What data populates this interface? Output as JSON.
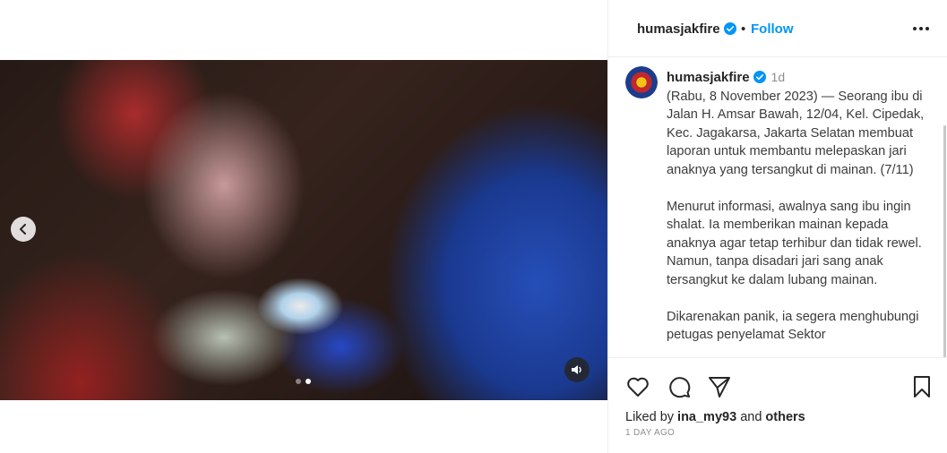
{
  "header": {
    "username": "humasjakfire",
    "separator": "•",
    "follow_label": "Follow",
    "more_icon": "more-horizontal-icon"
  },
  "post": {
    "media_description_icon": "video-carousel",
    "carousel": {
      "total": 2,
      "active": 2
    },
    "audio_icon": "speaker-icon"
  },
  "caption": {
    "username": "humasjakfire",
    "time_ago": "1d",
    "paragraphs": [
      "(Rabu, 8 November 2023) — Seorang ibu di Jalan H. Amsar Bawah, 12/04, Kel. Cipedak, Kec. Jagakarsa, Jakarta Selatan membuat laporan untuk membantu melepaskan jari anaknya yang tersangkut di mainan. (7/11)",
      "Menurut informasi, awalnya sang ibu ingin shalat. Ia memberikan mainan kepada anaknya agar tetap terhibur dan tidak rewel. Namun, tanpa disadari jari sang anak tersangkut ke dalam lubang mainan.",
      "Dikarenakan panik, ia segera menghubungi petugas penyelamat Sektor"
    ]
  },
  "likes": {
    "prefix": "Liked by",
    "user": "ina_my93",
    "and": "and",
    "others": "others"
  },
  "timestamp": "1 DAY AGO",
  "colors": {
    "accent": "#0095f6",
    "verified": "#0095f6",
    "text": "#262626",
    "muted": "#8e8e8e"
  }
}
